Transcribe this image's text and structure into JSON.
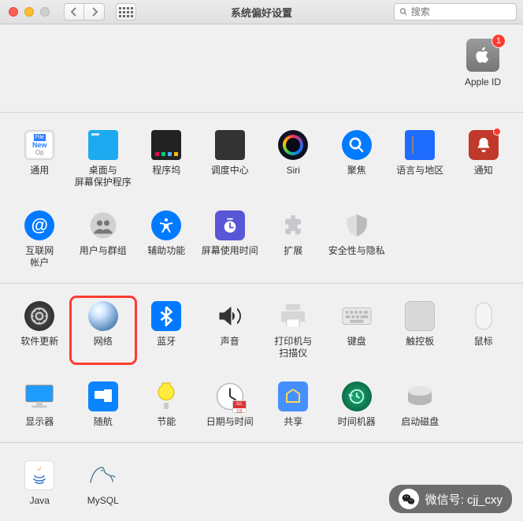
{
  "window": {
    "title": "系统偏好设置",
    "search_placeholder": "搜索"
  },
  "apple_id": {
    "label": "Apple ID",
    "badge": "1"
  },
  "rows": [
    [
      {
        "id": "general",
        "label": "通用"
      },
      {
        "id": "desktop",
        "label": "桌面与\n屏幕保护程序"
      },
      {
        "id": "dock",
        "label": "程序坞"
      },
      {
        "id": "mission",
        "label": "调度中心"
      },
      {
        "id": "siri",
        "label": "Siri"
      },
      {
        "id": "spotlight",
        "label": "聚焦"
      },
      {
        "id": "language",
        "label": "语言与地区"
      },
      {
        "id": "notifications",
        "label": "通知",
        "badge": true
      }
    ],
    [
      {
        "id": "internet-accounts",
        "label": "互联网\n帐户"
      },
      {
        "id": "users",
        "label": "用户与群组"
      },
      {
        "id": "accessibility",
        "label": "辅助功能"
      },
      {
        "id": "screentime",
        "label": "屏幕使用时间"
      },
      {
        "id": "extensions",
        "label": "扩展"
      },
      {
        "id": "security",
        "label": "安全性与隐私"
      }
    ],
    [
      {
        "id": "software-update",
        "label": "软件更新"
      },
      {
        "id": "network",
        "label": "网络",
        "highlight": true
      },
      {
        "id": "bluetooth",
        "label": "蓝牙"
      },
      {
        "id": "sound",
        "label": "声音"
      },
      {
        "id": "printers",
        "label": "打印机与\n扫描仪"
      },
      {
        "id": "keyboard",
        "label": "键盘"
      },
      {
        "id": "trackpad",
        "label": "触控板"
      },
      {
        "id": "mouse",
        "label": "鼠标"
      }
    ],
    [
      {
        "id": "displays",
        "label": "显示器"
      },
      {
        "id": "sidecar",
        "label": "随航"
      },
      {
        "id": "energy",
        "label": "节能"
      },
      {
        "id": "datetime",
        "label": "日期与时间"
      },
      {
        "id": "sharing",
        "label": "共享"
      },
      {
        "id": "timemachine",
        "label": "时间机器"
      },
      {
        "id": "startup",
        "label": "启动磁盘"
      }
    ],
    [
      {
        "id": "java",
        "label": "Java"
      },
      {
        "id": "mysql",
        "label": "MySQL"
      }
    ]
  ],
  "footer": {
    "text": "微信号: cjj_cxy"
  }
}
